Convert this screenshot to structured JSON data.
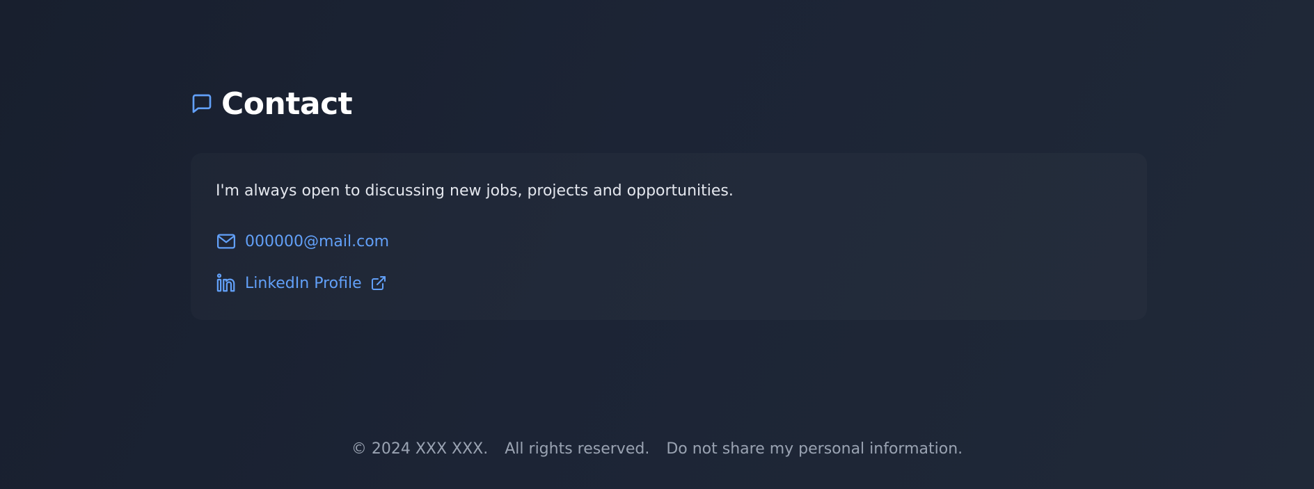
{
  "contact": {
    "title": "Contact",
    "title_icon": "chat-bubble-icon",
    "intro": "I'm always open to discussing new jobs, projects and opportunities.",
    "email": {
      "icon": "mail-icon",
      "label": "000000@mail.com"
    },
    "linkedin": {
      "icon": "linkedin-icon",
      "label": "LinkedIn Profile",
      "external_icon": "external-link-icon"
    }
  },
  "footer": {
    "copyright": "© 2024 XXX XXX.",
    "rights": "All rights reserved.",
    "privacy_link": "Do not share my personal information."
  },
  "colors": {
    "accent": "#62a0f8",
    "background": "#1c2435",
    "heading": "#ffffff",
    "muted": "#9aa3b2"
  }
}
